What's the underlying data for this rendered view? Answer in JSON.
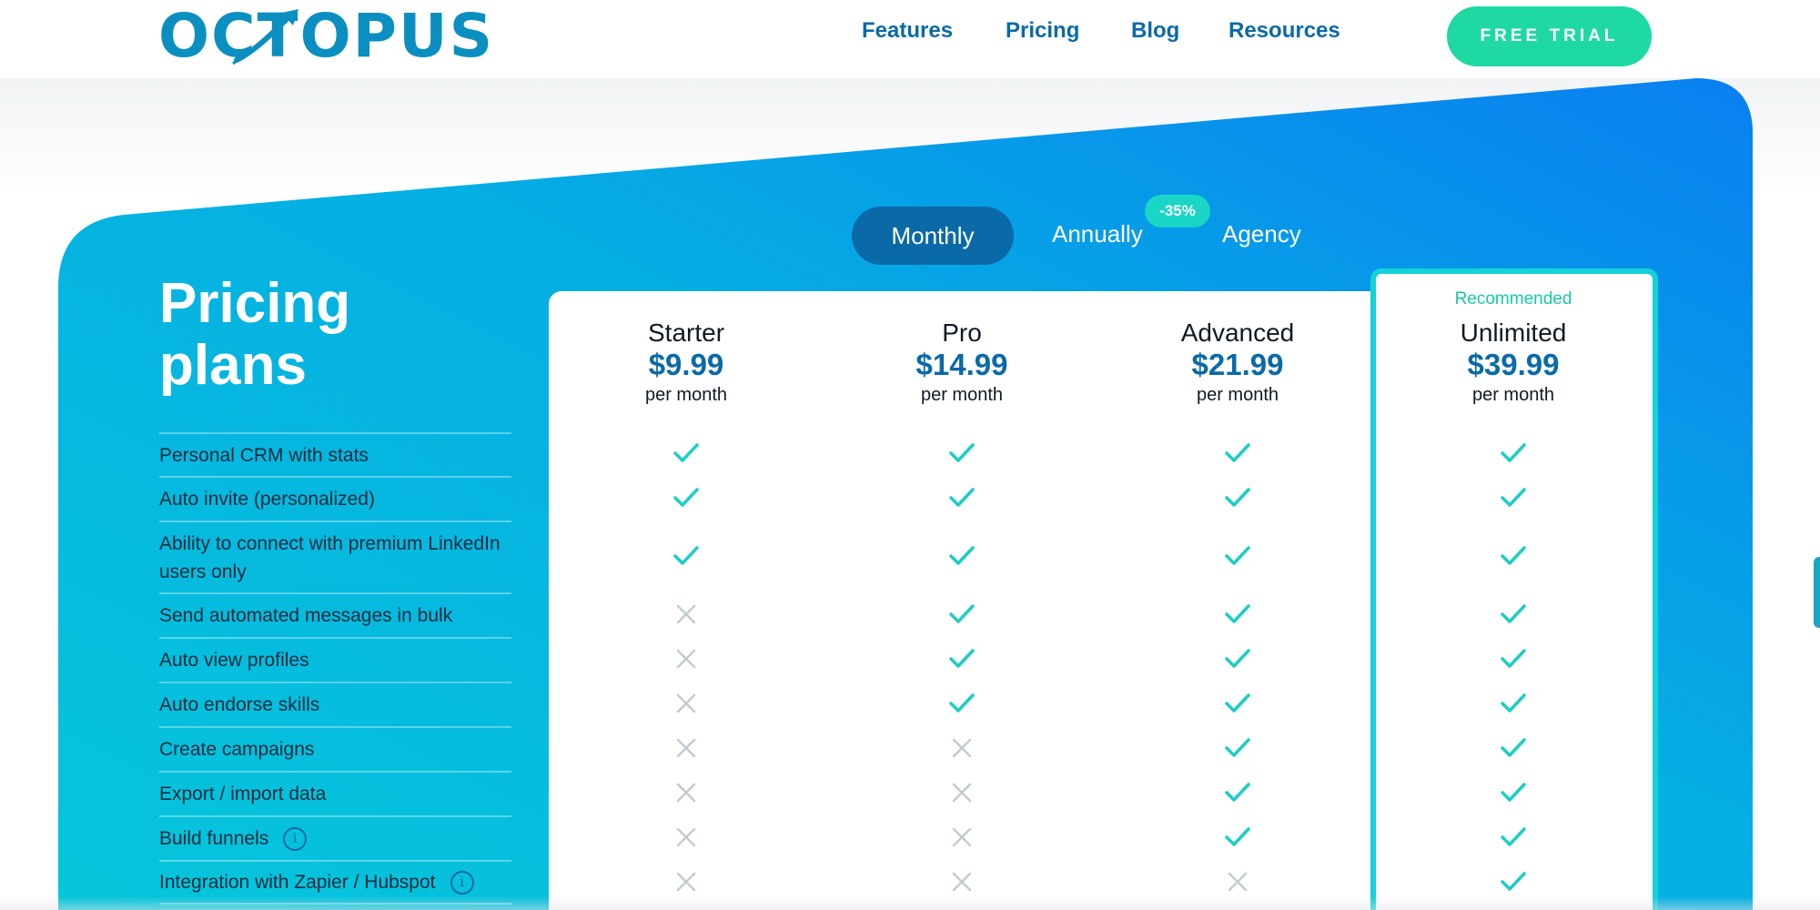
{
  "header": {
    "logo_text": "OCTOPUS",
    "nav": [
      {
        "label": "Features"
      },
      {
        "label": "Pricing"
      },
      {
        "label": "Blog"
      },
      {
        "label": "Resources"
      }
    ],
    "cta_label": "FREE TRIAL"
  },
  "billing_toggle": {
    "options": [
      "Monthly",
      "Annually",
      "Agency"
    ],
    "selected": "Monthly",
    "annual_discount": "-35%"
  },
  "section": {
    "title_line1": "Pricing",
    "title_line2": "plans"
  },
  "plans": [
    {
      "name": "Starter",
      "price": "$9.99",
      "period": "per month",
      "recommended": false
    },
    {
      "name": "Pro",
      "price": "$14.99",
      "period": "per month",
      "recommended": false
    },
    {
      "name": "Advanced",
      "price": "$21.99",
      "period": "per month",
      "recommended": false
    },
    {
      "name": "Unlimited",
      "price": "$39.99",
      "period": "per month",
      "recommended": true,
      "recommended_label": "Recommended"
    }
  ],
  "features": [
    {
      "label": "Personal CRM with stats",
      "info": false,
      "included": [
        true,
        true,
        true,
        true
      ]
    },
    {
      "label": "Auto invite (personalized)",
      "info": false,
      "included": [
        true,
        true,
        true,
        true
      ]
    },
    {
      "label": "Ability to connect with premium LinkedIn users only",
      "info": false,
      "included": [
        true,
        true,
        true,
        true
      ]
    },
    {
      "label": "Send automated messages in bulk",
      "info": false,
      "included": [
        false,
        true,
        true,
        true
      ]
    },
    {
      "label": "Auto view profiles",
      "info": false,
      "included": [
        false,
        true,
        true,
        true
      ]
    },
    {
      "label": "Auto endorse skills",
      "info": false,
      "included": [
        false,
        true,
        true,
        true
      ]
    },
    {
      "label": "Create campaigns",
      "info": false,
      "included": [
        false,
        false,
        true,
        true
      ]
    },
    {
      "label": "Export / import data",
      "info": false,
      "included": [
        false,
        false,
        true,
        true
      ]
    },
    {
      "label": "Build funnels",
      "info": true,
      "included": [
        false,
        false,
        true,
        true
      ]
    },
    {
      "label": "Integration with Zapier / Hubspot",
      "info": true,
      "included": [
        false,
        false,
        false,
        true
      ]
    }
  ],
  "colors": {
    "brand_blue": "#0a6aa8",
    "accent_green": "#1fd9a3",
    "check_teal": "#1ccdc6",
    "cross_gray": "#c2ccd3",
    "recommended_border": "#13d2d8"
  },
  "icons": {
    "included": "check-icon",
    "not_included": "cross-icon",
    "info": "info-icon"
  }
}
